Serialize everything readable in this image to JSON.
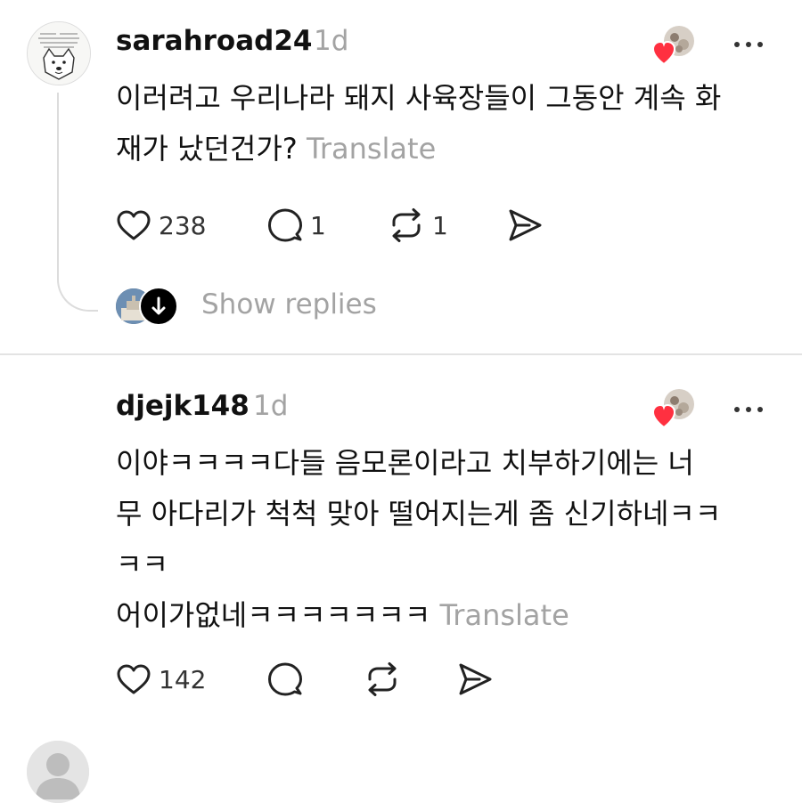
{
  "posts": [
    {
      "username": "sarahroad24",
      "time": "1d",
      "lines": [
        "이러려고 우리나라 돼지 사육장들이 그동안 계속 화",
        "재가 났던건가? "
      ],
      "translate": "Translate",
      "likes": "238",
      "comments": "1",
      "reposts": "1",
      "show_replies": "Show replies"
    },
    {
      "username": "djejk148",
      "time": "1d",
      "lines": [
        "이야ㅋㅋㅋㅋ다들 음모론이라고 치부하기에는 너",
        "무 아다리가 척척 맞아 떨어지는게 좀 신기하네ㅋㅋ",
        "ㅋㅋ",
        "어이가없네ㅋㅋㅋㅋㅋㅋㅋ "
      ],
      "translate": "Translate",
      "likes": "142"
    }
  ],
  "icons": {
    "like": "heart-icon",
    "comment": "comment-icon",
    "repost": "repost-icon",
    "share": "share-icon",
    "more": "more-icon",
    "liked_by": "heart-badge-icon",
    "expand": "arrow-down-icon"
  },
  "colors": {
    "text": "#111111",
    "muted": "#a3a3a3",
    "heart": "#ff3040",
    "divider": "#e3e3e3"
  }
}
